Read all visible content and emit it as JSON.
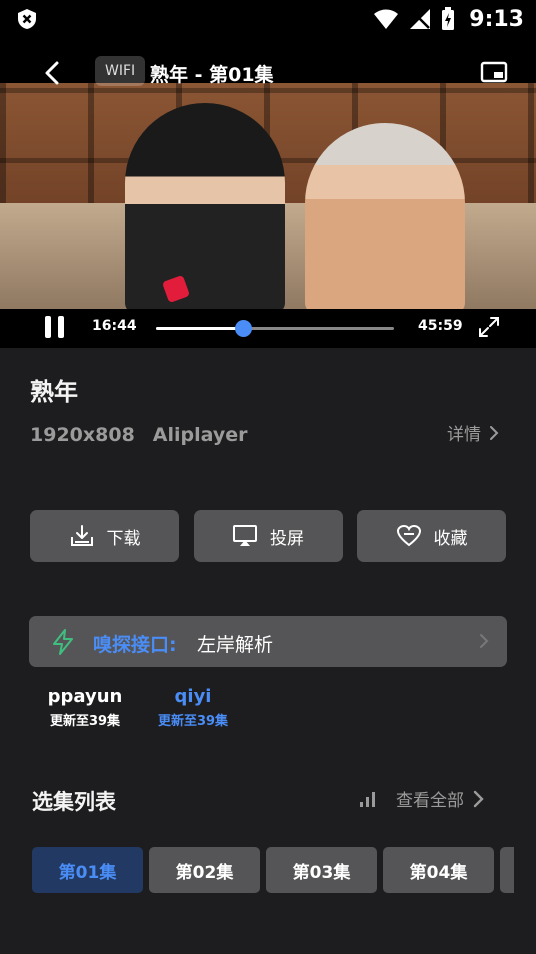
{
  "status_bar": {
    "time": "9:13"
  },
  "player": {
    "network_badge": "WIFI",
    "title": "熟年 - 第01集",
    "current_time": "16:44",
    "duration": "45:59",
    "progress": 0.364
  },
  "info": {
    "title": "熟年",
    "resolution": "1920x808",
    "player_name": "Aliplayer",
    "detail_label": "详情"
  },
  "actions": {
    "download": "下载",
    "cast": "投屏",
    "favorite": "收藏"
  },
  "parser": {
    "label": "嗅探接口:",
    "value": "左岸解析"
  },
  "sources": [
    {
      "name": "ppayun",
      "update": "更新至39集",
      "active": false
    },
    {
      "name": "qiyi",
      "update": "更新至39集",
      "active": true
    }
  ],
  "episodes": {
    "heading": "选集列表",
    "view_all": "查看全部",
    "items": [
      "第01集",
      "第02集",
      "第03集",
      "第04集"
    ],
    "active_index": 0
  },
  "colors": {
    "accent": "#4a8df6",
    "button_bg": "#555557",
    "page_bg": "#1d1d1f"
  }
}
